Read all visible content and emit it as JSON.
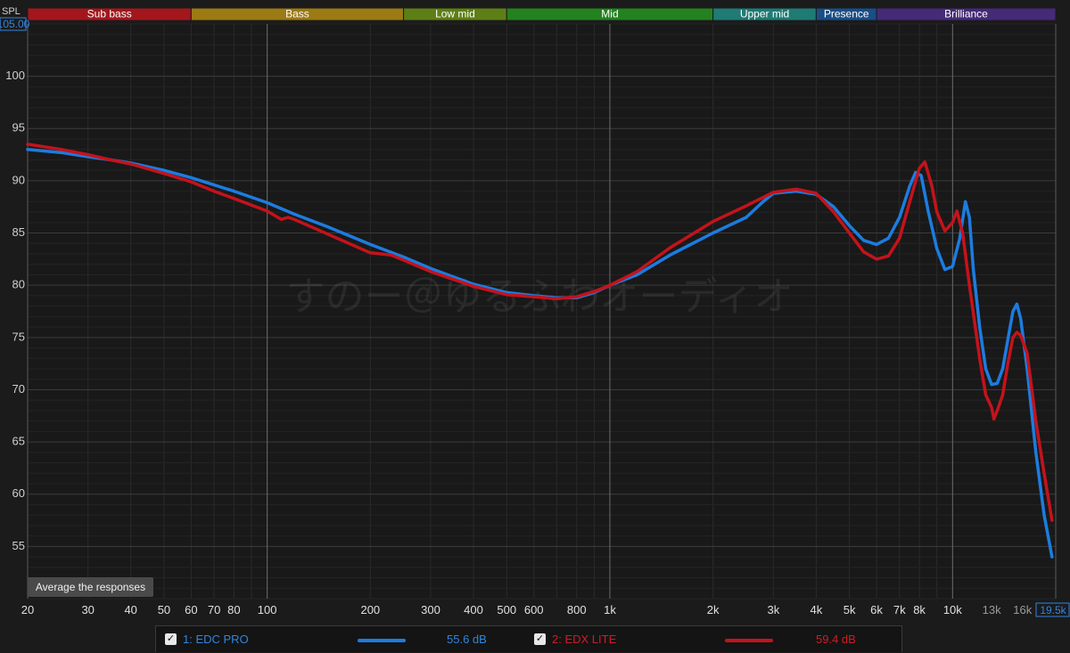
{
  "ui": {
    "y_axis_unit": "SPL",
    "y_max_value": "105.00",
    "x_max_value": "19.5k",
    "average_button": "Average the responses",
    "watermark": "すのー＠ゆるふわオーディオ"
  },
  "bands": [
    {
      "label": "Sub bass",
      "from": 20,
      "to": 60,
      "color": "#a3171c"
    },
    {
      "label": "Bass",
      "from": 60,
      "to": 250,
      "color": "#9c7a14"
    },
    {
      "label": "Low mid",
      "from": 250,
      "to": 500,
      "color": "#5e7f16"
    },
    {
      "label": "Mid",
      "from": 500,
      "to": 2000,
      "color": "#23821f"
    },
    {
      "label": "Upper mid",
      "from": 2000,
      "to": 4000,
      "color": "#1f7b74"
    },
    {
      "label": "Presence",
      "from": 4000,
      "to": 6000,
      "color": "#1a4e86"
    },
    {
      "label": "Brilliance",
      "from": 6000,
      "to": 20000,
      "color": "#452a77"
    }
  ],
  "legend": [
    {
      "index_label": "1: EDC PRO",
      "check": "✓",
      "value": "55.6 dB",
      "color": "#1c7ce0"
    },
    {
      "index_label": "2: EDX LITE",
      "check": "✓",
      "value": "59.4 dB",
      "color": "#c4131b"
    }
  ],
  "chart_data": {
    "type": "line",
    "xlabel": "",
    "ylabel": "SPL",
    "x_scale": "log",
    "xlim": [
      20,
      20000
    ],
    "ylim": [
      50,
      105
    ],
    "grid": true,
    "x_ticks": [
      {
        "v": 20,
        "label": "20"
      },
      {
        "v": 30,
        "label": "30"
      },
      {
        "v": 40,
        "label": "40"
      },
      {
        "v": 50,
        "label": "50"
      },
      {
        "v": 60,
        "label": "60"
      },
      {
        "v": 70,
        "label": "70"
      },
      {
        "v": 80,
        "label": "80"
      },
      {
        "v": 100,
        "label": "100"
      },
      {
        "v": 200,
        "label": "200"
      },
      {
        "v": 300,
        "label": "300"
      },
      {
        "v": 400,
        "label": "400"
      },
      {
        "v": 500,
        "label": "500"
      },
      {
        "v": 600,
        "label": "600"
      },
      {
        "v": 800,
        "label": "800"
      },
      {
        "v": 1000,
        "label": "1k"
      },
      {
        "v": 2000,
        "label": "2k"
      },
      {
        "v": 3000,
        "label": "3k"
      },
      {
        "v": 4000,
        "label": "4k"
      },
      {
        "v": 5000,
        "label": "5k"
      },
      {
        "v": 6000,
        "label": "6k"
      },
      {
        "v": 7000,
        "label": "7k"
      },
      {
        "v": 8000,
        "label": "8k"
      },
      {
        "v": 10000,
        "label": "10k"
      },
      {
        "v": 13000,
        "label": "13k"
      },
      {
        "v": 16000,
        "label": "16k"
      }
    ],
    "y_ticks": [
      55,
      60,
      65,
      70,
      75,
      80,
      85,
      90,
      95,
      100
    ],
    "series": [
      {
        "name": "1: EDC PRO",
        "color": "#1c7ce0",
        "points": [
          [
            20,
            93.0
          ],
          [
            25,
            92.7
          ],
          [
            30,
            92.3
          ],
          [
            35,
            92.0
          ],
          [
            40,
            91.7
          ],
          [
            50,
            91.0
          ],
          [
            60,
            90.3
          ],
          [
            70,
            89.6
          ],
          [
            80,
            89.0
          ],
          [
            100,
            87.9
          ],
          [
            120,
            86.8
          ],
          [
            150,
            85.6
          ],
          [
            200,
            83.9
          ],
          [
            250,
            82.7
          ],
          [
            300,
            81.6
          ],
          [
            400,
            80.1
          ],
          [
            500,
            79.3
          ],
          [
            600,
            79.0
          ],
          [
            700,
            78.8
          ],
          [
            800,
            78.8
          ],
          [
            900,
            79.3
          ],
          [
            1000,
            80.0
          ],
          [
            1200,
            81.0
          ],
          [
            1500,
            82.9
          ],
          [
            2000,
            85.0
          ],
          [
            2500,
            86.5
          ],
          [
            2800,
            88.0
          ],
          [
            3000,
            88.8
          ],
          [
            3500,
            89.0
          ],
          [
            4000,
            88.7
          ],
          [
            4500,
            87.5
          ],
          [
            5000,
            85.7
          ],
          [
            5500,
            84.3
          ],
          [
            6000,
            83.9
          ],
          [
            6500,
            84.5
          ],
          [
            7000,
            86.5
          ],
          [
            7500,
            89.5
          ],
          [
            7800,
            90.8
          ],
          [
            8100,
            90.5
          ],
          [
            8500,
            87.0
          ],
          [
            9000,
            83.5
          ],
          [
            9500,
            81.5
          ],
          [
            10000,
            81.8
          ],
          [
            10500,
            84.5
          ],
          [
            10900,
            88.0
          ],
          [
            11200,
            86.5
          ],
          [
            11500,
            81.5
          ],
          [
            12000,
            76.0
          ],
          [
            12500,
            72.0
          ],
          [
            13000,
            70.5
          ],
          [
            13500,
            70.6
          ],
          [
            14000,
            72.0
          ],
          [
            14500,
            74.8
          ],
          [
            15000,
            77.5
          ],
          [
            15400,
            78.2
          ],
          [
            15800,
            76.8
          ],
          [
            16500,
            72.0
          ],
          [
            17500,
            64.0
          ],
          [
            18500,
            58.0
          ],
          [
            19500,
            54.0
          ]
        ]
      },
      {
        "name": "2: EDX LITE",
        "color": "#c4131b",
        "points": [
          [
            20,
            93.5
          ],
          [
            25,
            93.0
          ],
          [
            30,
            92.5
          ],
          [
            35,
            92.0
          ],
          [
            40,
            91.6
          ],
          [
            50,
            90.7
          ],
          [
            60,
            89.9
          ],
          [
            70,
            89.0
          ],
          [
            80,
            88.3
          ],
          [
            100,
            87.1
          ],
          [
            110,
            86.3
          ],
          [
            115,
            86.5
          ],
          [
            120,
            86.3
          ],
          [
            150,
            84.9
          ],
          [
            200,
            83.1
          ],
          [
            230,
            82.9
          ],
          [
            250,
            82.4
          ],
          [
            300,
            81.3
          ],
          [
            400,
            79.9
          ],
          [
            500,
            79.1
          ],
          [
            600,
            78.9
          ],
          [
            700,
            78.7
          ],
          [
            800,
            78.9
          ],
          [
            900,
            79.4
          ],
          [
            1000,
            80.0
          ],
          [
            1200,
            81.3
          ],
          [
            1500,
            83.6
          ],
          [
            2000,
            86.1
          ],
          [
            2500,
            87.6
          ],
          [
            3000,
            88.9
          ],
          [
            3500,
            89.2
          ],
          [
            4000,
            88.8
          ],
          [
            4500,
            87.0
          ],
          [
            5000,
            85.0
          ],
          [
            5500,
            83.2
          ],
          [
            6000,
            82.5
          ],
          [
            6500,
            82.8
          ],
          [
            7000,
            84.5
          ],
          [
            7500,
            88.0
          ],
          [
            8000,
            91.2
          ],
          [
            8300,
            91.8
          ],
          [
            8700,
            89.5
          ],
          [
            9000,
            87.0
          ],
          [
            9500,
            85.2
          ],
          [
            10000,
            86.0
          ],
          [
            10300,
            87.1
          ],
          [
            10700,
            85.0
          ],
          [
            11200,
            80.0
          ],
          [
            12000,
            73.0
          ],
          [
            12500,
            69.5
          ],
          [
            13000,
            68.3
          ],
          [
            13200,
            67.2
          ],
          [
            13500,
            68.0
          ],
          [
            14000,
            69.5
          ],
          [
            14500,
            72.5
          ],
          [
            15000,
            75.0
          ],
          [
            15400,
            75.5
          ],
          [
            15800,
            75.2
          ],
          [
            16500,
            73.5
          ],
          [
            17500,
            67.0
          ],
          [
            18500,
            62.0
          ],
          [
            19500,
            57.5
          ]
        ]
      }
    ]
  }
}
